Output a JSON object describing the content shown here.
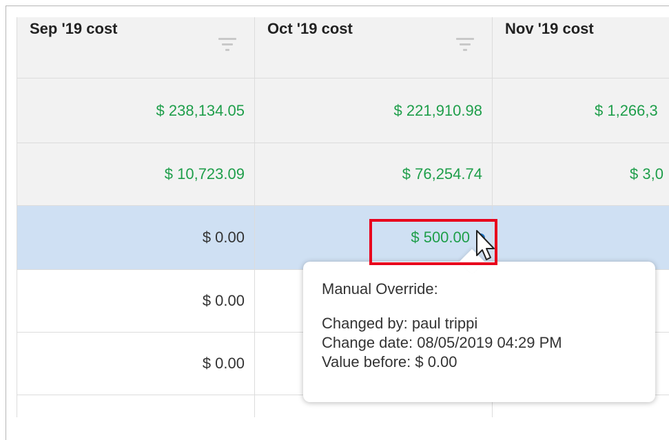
{
  "columns": [
    {
      "label": "Sep '19 cost"
    },
    {
      "label": "Oct '19 cost"
    },
    {
      "label": "Nov '19 cost"
    }
  ],
  "rows": [
    {
      "sep": "$ 238,134.05",
      "oct": "$ 221,910.98",
      "nov": "$ 1,266,3"
    },
    {
      "sep": "$ 10,723.09",
      "oct": "$ 76,254.74",
      "nov": "$ 3,0"
    },
    {
      "sep": "$ 0.00",
      "oct": "$ 500.00",
      "nov": ""
    },
    {
      "sep": "$ 0.00",
      "oct": "",
      "nov": ""
    },
    {
      "sep": "$ 0.00",
      "oct": "",
      "nov": ""
    },
    {
      "sep": "",
      "oct": "",
      "nov": ""
    }
  ],
  "tooltip": {
    "title": "Manual Override:",
    "changed_by": "Changed by: paul trippi",
    "change_date": "Change date: 08/05/2019 04:29 PM",
    "value_before": "Value before: $ 0.00"
  },
  "colors": {
    "positive_value": "#1e9e4a",
    "selected_row": "#cfe0f3",
    "highlight": "#e8001c",
    "override_indicator": "#1a73c8"
  },
  "icons": [
    "filter-icon",
    "override-indicator-icon",
    "mouse-cursor-icon"
  ]
}
